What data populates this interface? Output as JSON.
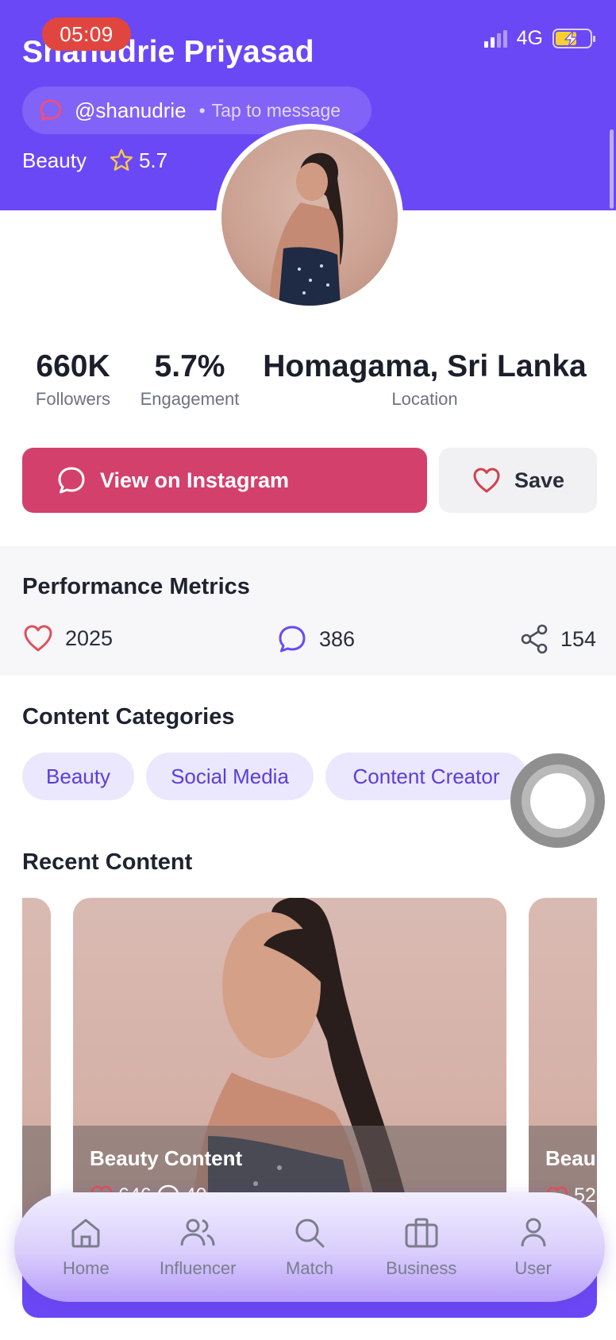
{
  "status_bar": {
    "time": "05:09",
    "network": "4G",
    "battery_color": "#f7d02f"
  },
  "profile": {
    "name": "Shanudrie Priyasad",
    "handle": "@shanudrie",
    "message_hint": "Tap to message",
    "category": "Beauty",
    "rating": "5.7",
    "header_color": "#6b48f6"
  },
  "stats": [
    {
      "value": "660K",
      "label": "Followers"
    },
    {
      "value": "5.7%",
      "label": "Engagement"
    },
    {
      "value": "Homagama, Sri Lanka",
      "label": "Location"
    }
  ],
  "actions": {
    "instagram_label": "View on Instagram",
    "save_label": "Save",
    "instagram_color": "#d3406b"
  },
  "performance": {
    "title": "Performance Metrics",
    "likes": "2025",
    "comments": "386",
    "shares": "154"
  },
  "categories": {
    "title": "Content Categories",
    "items": [
      "Beauty",
      "Social Media",
      "Content Creator"
    ]
  },
  "recent": {
    "title": "Recent Content",
    "cards": [
      {
        "title": "Beauty Content",
        "likes": "646",
        "comments": "40"
      },
      {
        "title": "Beau",
        "likes": "52"
      }
    ]
  },
  "nav": {
    "items": [
      {
        "label": "Home",
        "icon": "home-icon"
      },
      {
        "label": "Influencer",
        "icon": "users-icon"
      },
      {
        "label": "Match",
        "icon": "search-icon"
      },
      {
        "label": "Business",
        "icon": "briefcase-icon"
      },
      {
        "label": "User",
        "icon": "user-icon"
      }
    ]
  }
}
